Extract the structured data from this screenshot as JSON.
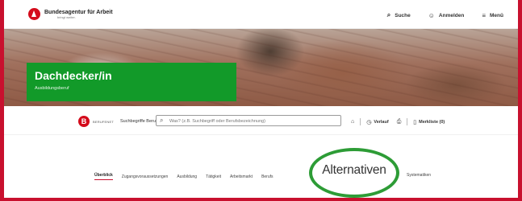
{
  "header": {
    "brand_title": "Bundesagentur für Arbeit",
    "brand_tagline": "bringt weiter.",
    "nav": [
      {
        "label": "Suche",
        "icon": "search-icon",
        "glyph": "⌕"
      },
      {
        "label": "Anmelden",
        "icon": "user-icon",
        "glyph": "☺"
      },
      {
        "label": "Menü",
        "icon": "menu-icon",
        "glyph": "≡"
      }
    ]
  },
  "hero": {
    "title": "Dachdecker/in",
    "subtitle": "Ausbildungsberuf",
    "accent_color": "#129a29"
  },
  "searchbar": {
    "logo_letter": "B",
    "logo_text": "BERUFENET",
    "label": "Suchbegriffe Beruf",
    "placeholder": "Was? (z.B. Suchbegriff oder Berufsbezeichnung)",
    "history_label": "Verlauf",
    "watchlist_label": "Merkliste (0)"
  },
  "tabs": [
    {
      "label": "Überblick",
      "active": true
    },
    {
      "label": "Zugangsvoraussetzungen",
      "active": false
    },
    {
      "label": "Ausbildung",
      "active": false
    },
    {
      "label": "Tätigkeit",
      "active": false
    },
    {
      "label": "Arbeitsmarkt",
      "active": false
    },
    {
      "label": "Berufs",
      "active": false
    },
    {
      "label": "Systematiken",
      "active": false
    }
  ],
  "callout": {
    "label": "Alternativen",
    "ring_color": "#2d9c36"
  },
  "colors": {
    "brand_red": "#d40b1b",
    "frame": "#c8102e"
  }
}
